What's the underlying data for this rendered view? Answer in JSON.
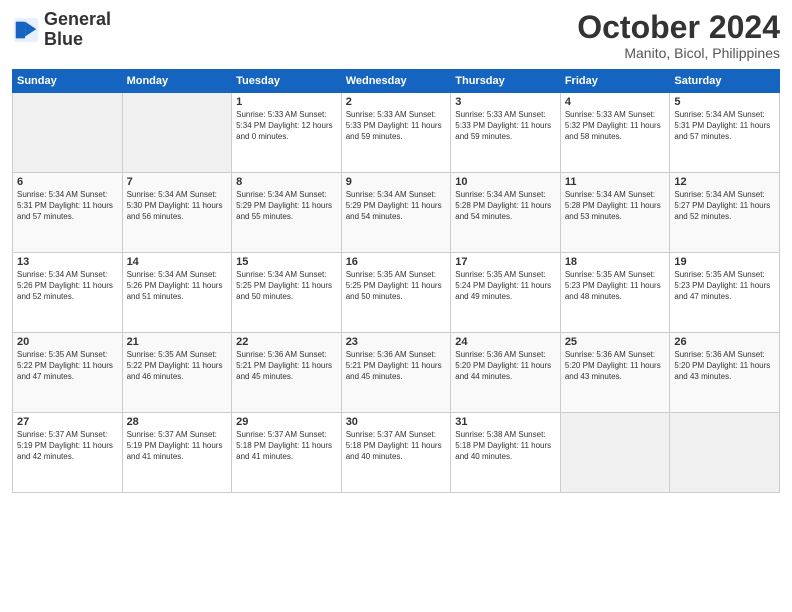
{
  "logo": {
    "line1": "General",
    "line2": "Blue"
  },
  "title": "October 2024",
  "subtitle": "Manito, Bicol, Philippines",
  "days_header": [
    "Sunday",
    "Monday",
    "Tuesday",
    "Wednesday",
    "Thursday",
    "Friday",
    "Saturday"
  ],
  "weeks": [
    [
      {
        "day": "",
        "info": ""
      },
      {
        "day": "",
        "info": ""
      },
      {
        "day": "1",
        "info": "Sunrise: 5:33 AM\nSunset: 5:34 PM\nDaylight: 12 hours\nand 0 minutes."
      },
      {
        "day": "2",
        "info": "Sunrise: 5:33 AM\nSunset: 5:33 PM\nDaylight: 11 hours\nand 59 minutes."
      },
      {
        "day": "3",
        "info": "Sunrise: 5:33 AM\nSunset: 5:33 PM\nDaylight: 11 hours\nand 59 minutes."
      },
      {
        "day": "4",
        "info": "Sunrise: 5:33 AM\nSunset: 5:32 PM\nDaylight: 11 hours\nand 58 minutes."
      },
      {
        "day": "5",
        "info": "Sunrise: 5:34 AM\nSunset: 5:31 PM\nDaylight: 11 hours\nand 57 minutes."
      }
    ],
    [
      {
        "day": "6",
        "info": "Sunrise: 5:34 AM\nSunset: 5:31 PM\nDaylight: 11 hours\nand 57 minutes."
      },
      {
        "day": "7",
        "info": "Sunrise: 5:34 AM\nSunset: 5:30 PM\nDaylight: 11 hours\nand 56 minutes."
      },
      {
        "day": "8",
        "info": "Sunrise: 5:34 AM\nSunset: 5:29 PM\nDaylight: 11 hours\nand 55 minutes."
      },
      {
        "day": "9",
        "info": "Sunrise: 5:34 AM\nSunset: 5:29 PM\nDaylight: 11 hours\nand 54 minutes."
      },
      {
        "day": "10",
        "info": "Sunrise: 5:34 AM\nSunset: 5:28 PM\nDaylight: 11 hours\nand 54 minutes."
      },
      {
        "day": "11",
        "info": "Sunrise: 5:34 AM\nSunset: 5:28 PM\nDaylight: 11 hours\nand 53 minutes."
      },
      {
        "day": "12",
        "info": "Sunrise: 5:34 AM\nSunset: 5:27 PM\nDaylight: 11 hours\nand 52 minutes."
      }
    ],
    [
      {
        "day": "13",
        "info": "Sunrise: 5:34 AM\nSunset: 5:26 PM\nDaylight: 11 hours\nand 52 minutes."
      },
      {
        "day": "14",
        "info": "Sunrise: 5:34 AM\nSunset: 5:26 PM\nDaylight: 11 hours\nand 51 minutes."
      },
      {
        "day": "15",
        "info": "Sunrise: 5:34 AM\nSunset: 5:25 PM\nDaylight: 11 hours\nand 50 minutes."
      },
      {
        "day": "16",
        "info": "Sunrise: 5:35 AM\nSunset: 5:25 PM\nDaylight: 11 hours\nand 50 minutes."
      },
      {
        "day": "17",
        "info": "Sunrise: 5:35 AM\nSunset: 5:24 PM\nDaylight: 11 hours\nand 49 minutes."
      },
      {
        "day": "18",
        "info": "Sunrise: 5:35 AM\nSunset: 5:23 PM\nDaylight: 11 hours\nand 48 minutes."
      },
      {
        "day": "19",
        "info": "Sunrise: 5:35 AM\nSunset: 5:23 PM\nDaylight: 11 hours\nand 47 minutes."
      }
    ],
    [
      {
        "day": "20",
        "info": "Sunrise: 5:35 AM\nSunset: 5:22 PM\nDaylight: 11 hours\nand 47 minutes."
      },
      {
        "day": "21",
        "info": "Sunrise: 5:35 AM\nSunset: 5:22 PM\nDaylight: 11 hours\nand 46 minutes."
      },
      {
        "day": "22",
        "info": "Sunrise: 5:36 AM\nSunset: 5:21 PM\nDaylight: 11 hours\nand 45 minutes."
      },
      {
        "day": "23",
        "info": "Sunrise: 5:36 AM\nSunset: 5:21 PM\nDaylight: 11 hours\nand 45 minutes."
      },
      {
        "day": "24",
        "info": "Sunrise: 5:36 AM\nSunset: 5:20 PM\nDaylight: 11 hours\nand 44 minutes."
      },
      {
        "day": "25",
        "info": "Sunrise: 5:36 AM\nSunset: 5:20 PM\nDaylight: 11 hours\nand 43 minutes."
      },
      {
        "day": "26",
        "info": "Sunrise: 5:36 AM\nSunset: 5:20 PM\nDaylight: 11 hours\nand 43 minutes."
      }
    ],
    [
      {
        "day": "27",
        "info": "Sunrise: 5:37 AM\nSunset: 5:19 PM\nDaylight: 11 hours\nand 42 minutes."
      },
      {
        "day": "28",
        "info": "Sunrise: 5:37 AM\nSunset: 5:19 PM\nDaylight: 11 hours\nand 41 minutes."
      },
      {
        "day": "29",
        "info": "Sunrise: 5:37 AM\nSunset: 5:18 PM\nDaylight: 11 hours\nand 41 minutes."
      },
      {
        "day": "30",
        "info": "Sunrise: 5:37 AM\nSunset: 5:18 PM\nDaylight: 11 hours\nand 40 minutes."
      },
      {
        "day": "31",
        "info": "Sunrise: 5:38 AM\nSunset: 5:18 PM\nDaylight: 11 hours\nand 40 minutes."
      },
      {
        "day": "",
        "info": ""
      },
      {
        "day": "",
        "info": ""
      }
    ]
  ]
}
